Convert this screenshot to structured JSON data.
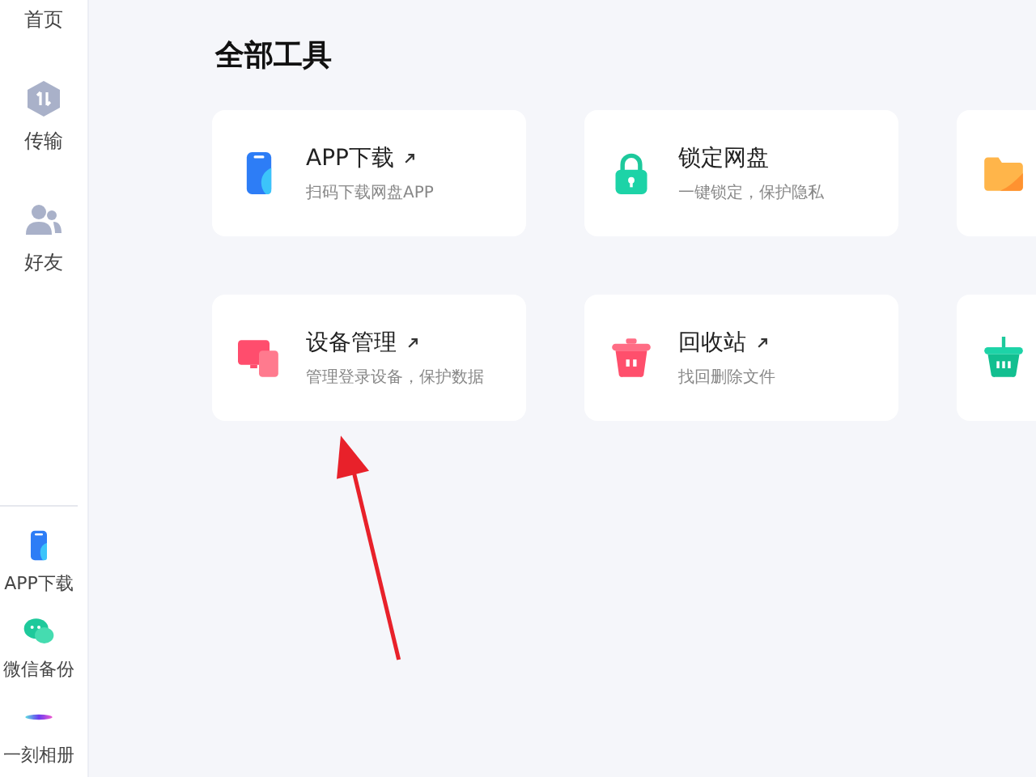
{
  "sidebar": {
    "top_items": [
      {
        "kind": "home",
        "label": "首页"
      },
      {
        "kind": "transfer",
        "label": "传输"
      },
      {
        "kind": "friends",
        "label": "好友"
      }
    ],
    "bottom_items": [
      {
        "kind": "phone",
        "label": "APP下载"
      },
      {
        "kind": "chat",
        "label": "微信备份"
      },
      {
        "kind": "album",
        "label": "一刻相册"
      }
    ]
  },
  "title": "全部工具",
  "tools": [
    {
      "kind": "phone",
      "name": "APP下载",
      "external": true,
      "description": "扫码下载网盘APP"
    },
    {
      "kind": "lock",
      "name": "锁定网盘",
      "external": false,
      "description": "一键锁定，保护隐私"
    },
    {
      "kind": "folder"
    },
    {
      "kind": "devices",
      "name": "设备管理",
      "external": true,
      "description": "管理登录设备，保护数据"
    },
    {
      "kind": "trash",
      "name": "回收站",
      "external": true,
      "description": "找回删除文件"
    },
    {
      "kind": "basket"
    }
  ]
}
